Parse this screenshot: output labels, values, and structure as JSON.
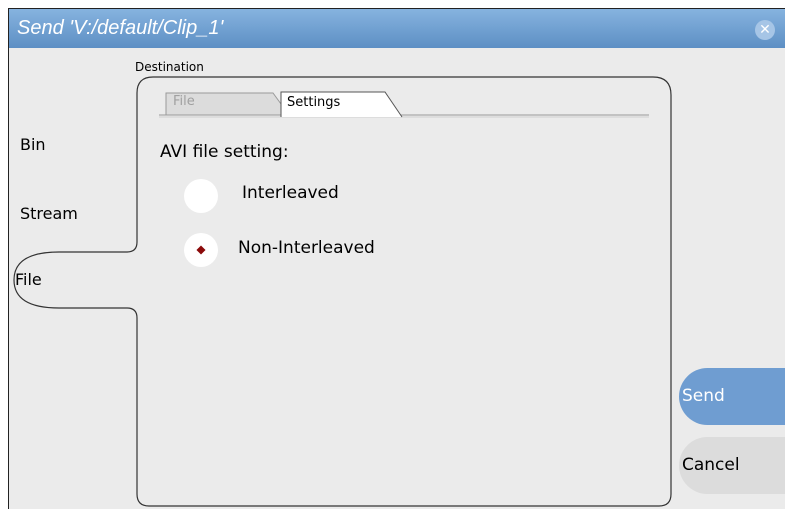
{
  "window": {
    "title": "Send 'V:/default/Clip_1'",
    "close_glyph": "✕"
  },
  "destination_label": "Destination",
  "sidebar": {
    "items": [
      {
        "label": "Bin"
      },
      {
        "label": "Stream"
      },
      {
        "label": "File",
        "selected": true
      }
    ]
  },
  "tabs": [
    {
      "label": "File",
      "active": false
    },
    {
      "label": "Settings",
      "active": true
    }
  ],
  "settings": {
    "heading": "AVI file setting:",
    "options": [
      {
        "label": "Interleaved",
        "selected": false
      },
      {
        "label": "Non-Interleaved",
        "selected": true
      }
    ]
  },
  "actions": {
    "send_label": "Send",
    "cancel_label": "Cancel"
  },
  "colors": {
    "titlebar": "#6d9ed2",
    "send_button": "#6f9dd1",
    "radio_selected": "#8b0a0a"
  }
}
